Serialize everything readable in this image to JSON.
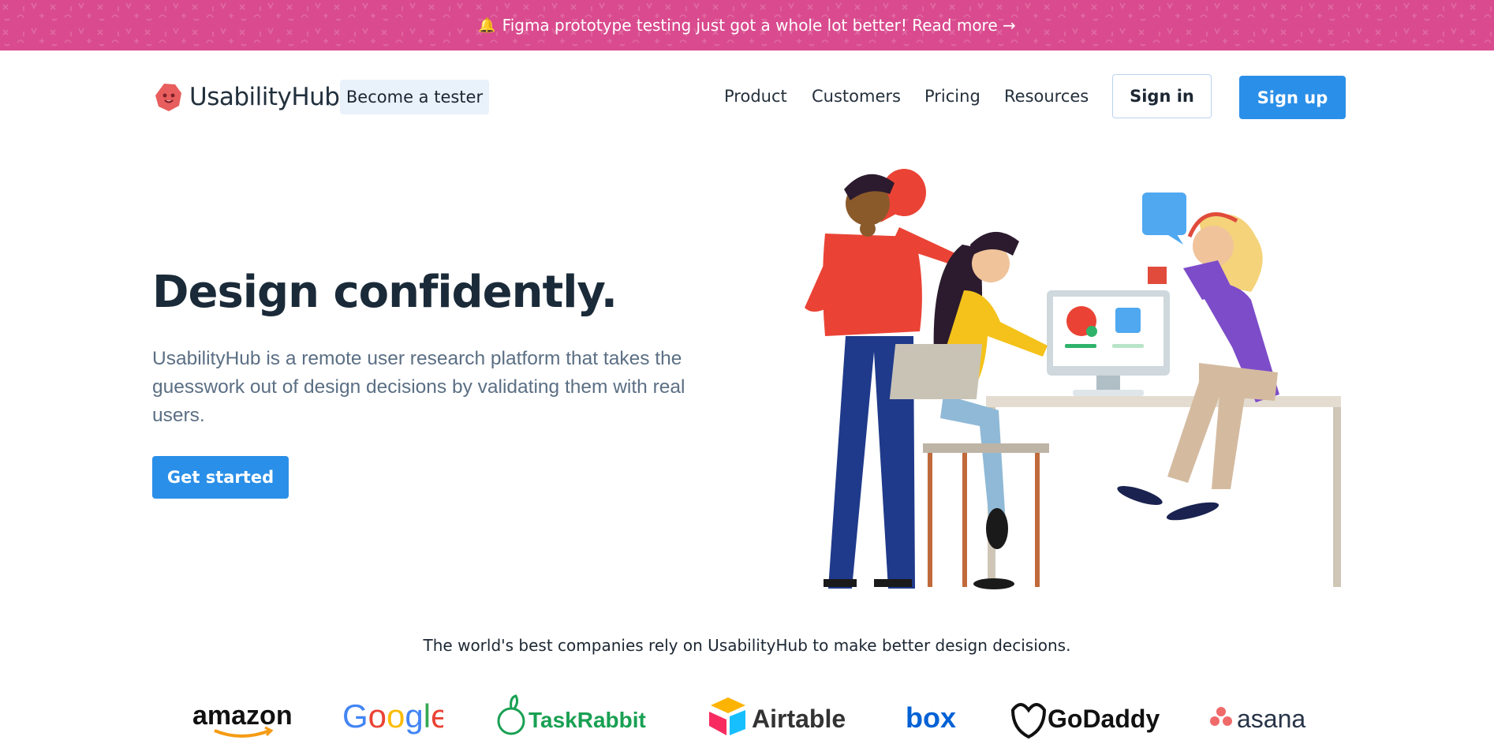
{
  "banner": {
    "icon": "bell-icon",
    "text": "Figma prototype testing just got a whole lot better! Read more →",
    "background": "#d94b8e"
  },
  "header": {
    "logo_text": "UsabilityHub",
    "become_tester": "Become a tester",
    "nav": {
      "product": "Product",
      "customers": "Customers",
      "pricing": "Pricing",
      "resources": "Resources"
    },
    "sign_in": "Sign in",
    "sign_up": "Sign up"
  },
  "hero": {
    "title": "Design confidently.",
    "description": "UsabilityHub is a remote user research platform that takes the guesswork out of design decisions by validating them with real users.",
    "cta": "Get started"
  },
  "trust": {
    "text": "The world's best companies rely on UsabilityHub to make better design decisions.",
    "companies": [
      "amazon",
      "Google",
      "TaskRabbit",
      "Airtable",
      "box",
      "GoDaddy",
      "asana"
    ]
  },
  "colors": {
    "accent": "#2a8fe8",
    "heading": "#1a2a38",
    "body": "#5b6f84"
  }
}
